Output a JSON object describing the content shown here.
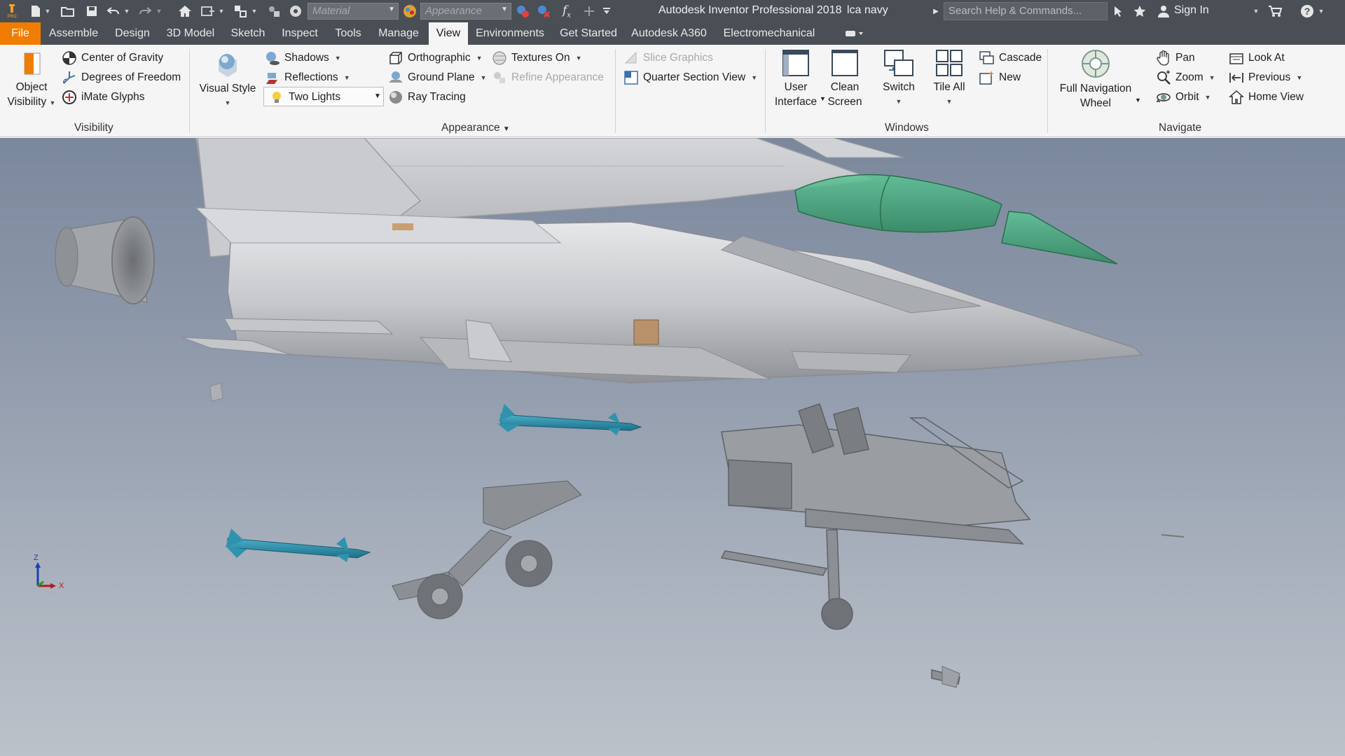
{
  "title_bar": {
    "app_title": "Autodesk Inventor Professional 2018",
    "document_title": "lca navy",
    "material_placeholder": "Material",
    "appearance_placeholder": "Appearance",
    "search_placeholder": "Search Help & Commands...",
    "sign_in": "Sign In",
    "app_logo_sub": "PRO"
  },
  "menu_tabs": [
    "File",
    "Assemble",
    "Design",
    "3D Model",
    "Sketch",
    "Inspect",
    "Tools",
    "Manage",
    "View",
    "Environments",
    "Get Started",
    "Autodesk A360",
    "Electromechanical"
  ],
  "active_tab": "View",
  "ribbon": {
    "visibility": {
      "label": "Visibility",
      "object_visibility": [
        "Object",
        "Visibility"
      ],
      "center_of_gravity": "Center of Gravity",
      "degrees_of_freedom": "Degrees of Freedom",
      "imate_glyphs": "iMate Glyphs"
    },
    "appearance": {
      "label": "Appearance",
      "visual_style": "Visual Style",
      "shadows": "Shadows",
      "reflections": "Reflections",
      "lighting": "Two Lights",
      "orthographic": "Orthographic",
      "textures": "Textures On",
      "ground_plane": "Ground Plane",
      "refine_appearance": "Refine Appearance",
      "ray_tracing": "Ray Tracing",
      "slice_graphics": "Slice Graphics",
      "quarter_section_view": "Quarter Section View"
    },
    "windows": {
      "label": "Windows",
      "user_interface": [
        "User",
        "Interface"
      ],
      "clean_screen": [
        "Clean",
        "Screen"
      ],
      "switch": "Switch",
      "tile_all": "Tile All",
      "cascade": "Cascade",
      "new": "New"
    },
    "navigate": {
      "label": "Navigate",
      "full_navigation_wheel": [
        "Full Navigation",
        "Wheel"
      ],
      "pan": "Pan",
      "zoom": "Zoom",
      "orbit": "Orbit",
      "look_at": "Look At",
      "previous": "Previous",
      "home_view": "Home View"
    }
  },
  "viewport": {
    "axis_labels": {
      "z": "Z",
      "x": "X"
    },
    "colors": {
      "canopy": "#3fa87a",
      "missile": "#2f93ae",
      "body": "#d3d5d8",
      "structure": "#8c8f94"
    }
  },
  "colors": {
    "title_bar": "#4a4f56",
    "file_tab": "#f07d00",
    "ribbon_bg": "#f5f5f5"
  }
}
